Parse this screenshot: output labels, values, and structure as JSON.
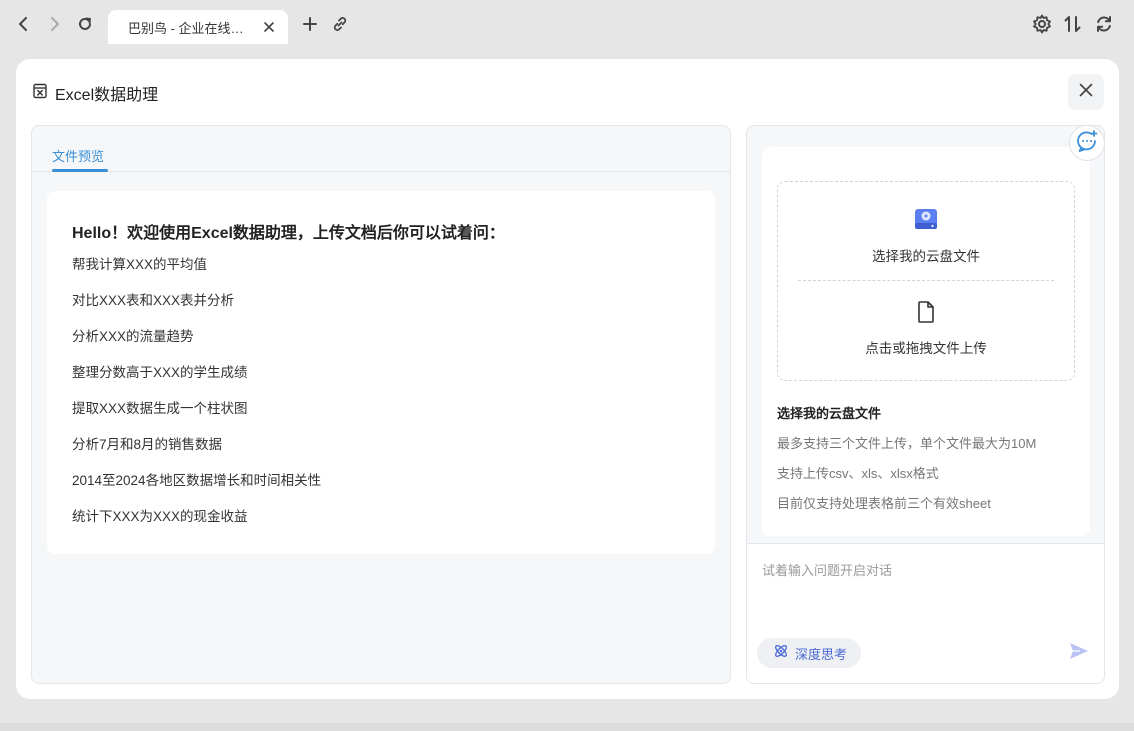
{
  "browser": {
    "tab_title": "巴别鸟 - 企业在线办…",
    "icons": [
      "back-icon",
      "forward-icon",
      "reload-icon",
      "new-tab-icon",
      "link-icon",
      "settings-icon",
      "sort-icon",
      "sync-icon"
    ]
  },
  "modal": {
    "title": "Excel数据助理"
  },
  "left_panel": {
    "tab_label": "文件预览",
    "welcome_title": "Hello！欢迎使用Excel数据助理，上传文档后你可以试着问：",
    "suggestions": [
      "帮我计算XXX的平均值",
      "对比XXX表和XXX表并分析",
      "分析XXX的流量趋势",
      "整理分数高于XXX的学生成绩",
      "提取XXX数据生成一个柱状图",
      "分析7月和8月的销售数据",
      "2014至2024各地区数据增长和时间相关性",
      "统计下XXX为XXX的现金收益"
    ]
  },
  "right_panel": {
    "cloud_select_label": "选择我的云盘文件",
    "upload_label": "点击或拖拽文件上传",
    "info_title": "选择我的云盘文件",
    "info_lines": [
      "最多支持三个文件上传，单个文件最大为10M",
      "支持上传csv、xls、xlsx格式",
      "目前仅支持处理表格前三个有效sheet"
    ],
    "chat_placeholder": "试着输入问题开启对话",
    "deep_think_label": "深度思考"
  },
  "colors": {
    "accent": "#3a8fd8",
    "deep_think": "#4a6bd6",
    "send_icon": "#b9c3f5"
  }
}
